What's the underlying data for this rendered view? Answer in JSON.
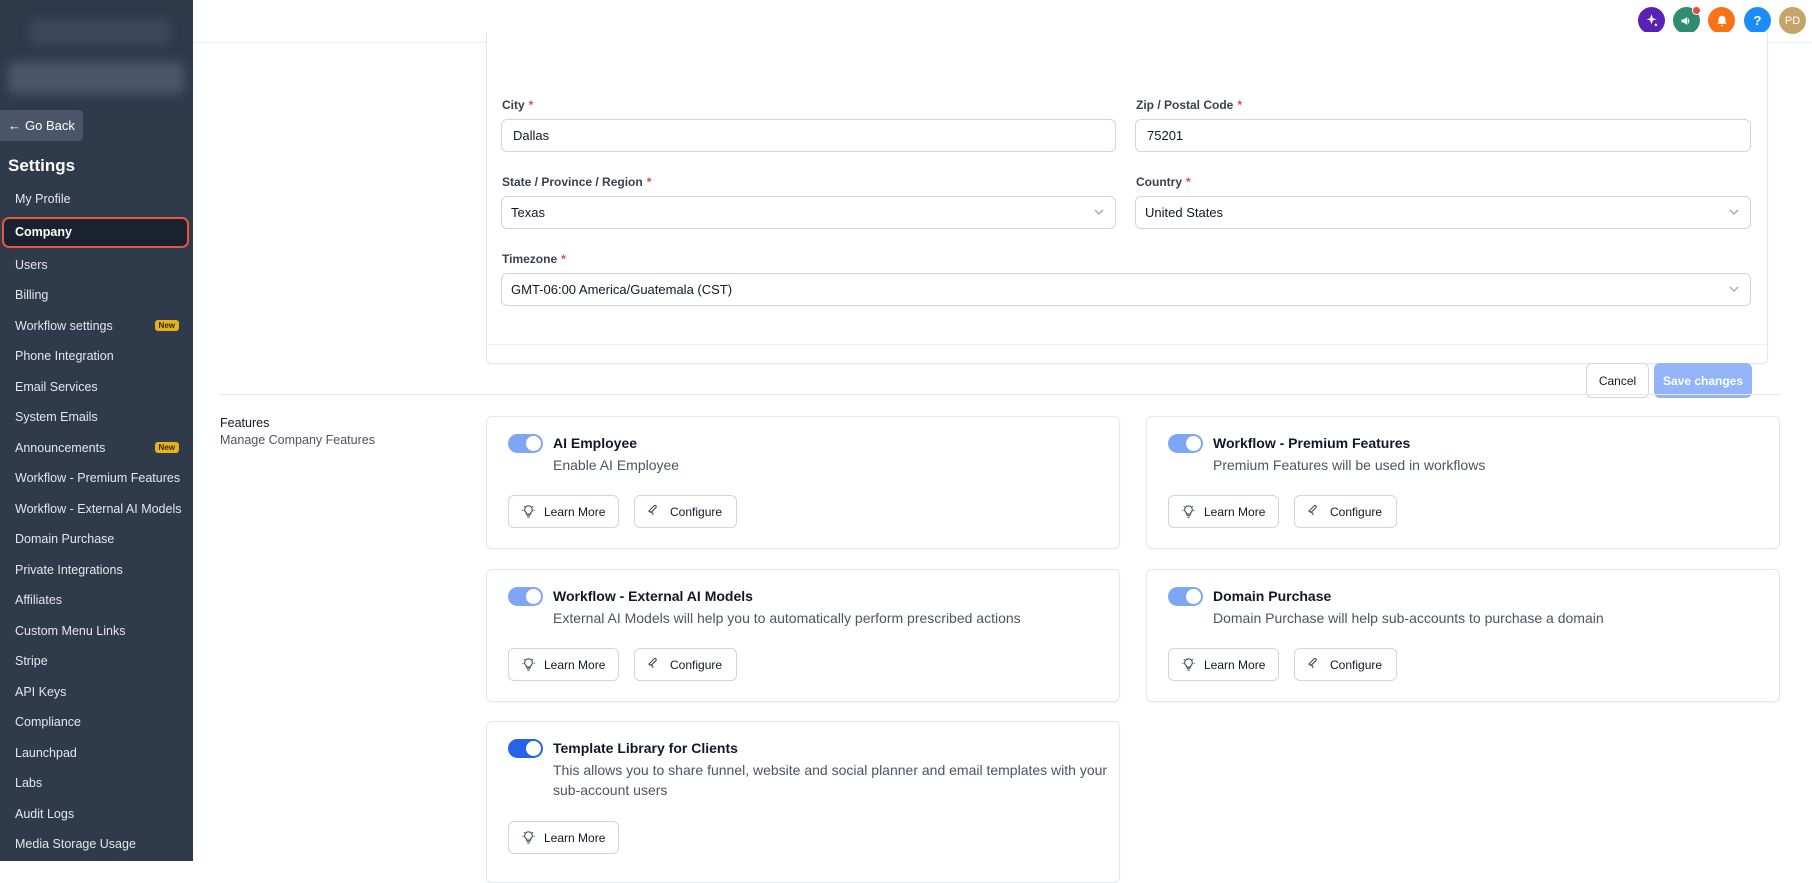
{
  "sidebar": {
    "go_back": "Go Back",
    "title": "Settings",
    "items": [
      {
        "label": "My Profile"
      },
      {
        "label": "Company",
        "active": true
      },
      {
        "label": "Users"
      },
      {
        "label": "Billing"
      },
      {
        "label": "Workflow settings",
        "badge": "New"
      },
      {
        "label": "Phone Integration"
      },
      {
        "label": "Email Services"
      },
      {
        "label": "System Emails"
      },
      {
        "label": "Announcements",
        "badge": "New"
      },
      {
        "label": "Workflow - Premium Features"
      },
      {
        "label": "Workflow - External AI Models"
      },
      {
        "label": "Domain Purchase"
      },
      {
        "label": "Private Integrations"
      },
      {
        "label": "Affiliates"
      },
      {
        "label": "Custom Menu Links"
      },
      {
        "label": "Stripe"
      },
      {
        "label": "API Keys"
      },
      {
        "label": "Compliance"
      },
      {
        "label": "Launchpad"
      },
      {
        "label": "Labs"
      },
      {
        "label": "Audit Logs"
      },
      {
        "label": "Media Storage Usage"
      }
    ]
  },
  "header": {
    "icons": [
      "sparkle-icon",
      "megaphone-icon",
      "bell-icon",
      "help-icon"
    ],
    "help_glyph": "?",
    "avatar_initials": "PD",
    "colors": {
      "sparkle": "#5b21b6",
      "megaphone": "#2f8c6f",
      "bell": "#f97316",
      "help": "#1d8cf8",
      "avatar": "#c7a36a"
    }
  },
  "address": {
    "city_label": "City",
    "city_value": "Dallas",
    "zip_label": "Zip / Postal Code",
    "zip_value": "75201",
    "state_label": "State / Province / Region",
    "state_value": "Texas",
    "country_label": "Country",
    "country_value": "United States",
    "timezone_label": "Timezone",
    "timezone_value": "GMT-06:00 America/Guatemala (CST)",
    "required_mark": "*",
    "cancel_label": "Cancel",
    "save_label": "Save changes"
  },
  "features": {
    "title": "Features",
    "subtitle": "Manage Company Features",
    "learn_more_label": "Learn More",
    "configure_label": "Configure",
    "items": [
      {
        "title": "AI Employee",
        "desc": "Enable AI Employee"
      },
      {
        "title": "Workflow - Premium Features",
        "desc": "Premium Features will be used in workflows"
      },
      {
        "title": "Workflow - External AI Models",
        "desc": "External AI Models will help you to automatically perform prescribed actions"
      },
      {
        "title": "Domain Purchase",
        "desc": "Domain Purchase will help sub-accounts to purchase a domain"
      },
      {
        "title": "Template Library for Clients",
        "desc": "This allows you to share funnel, website and social planner and email templates with your sub-account users"
      }
    ]
  }
}
